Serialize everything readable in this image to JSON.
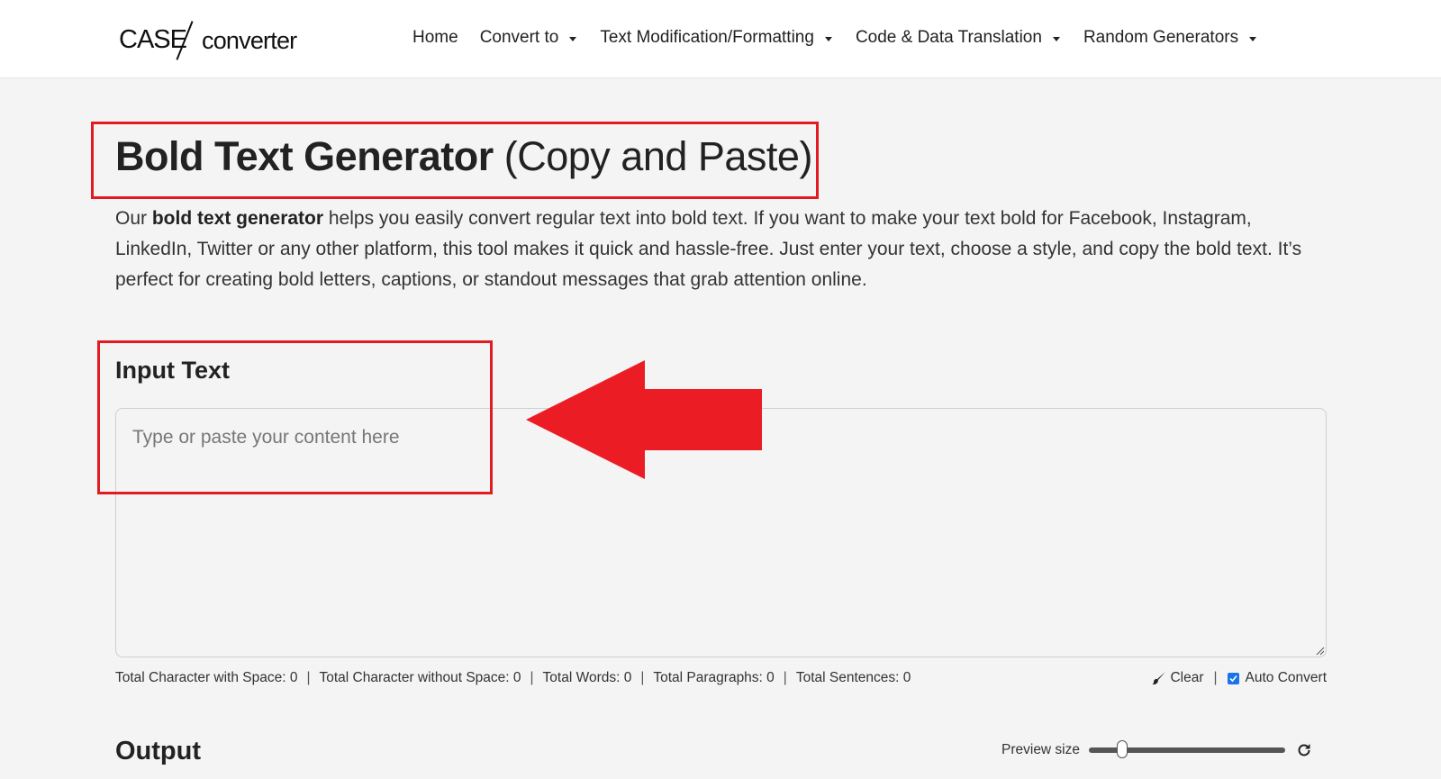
{
  "brand": {
    "logo_left": "CASE",
    "logo_right": "converter"
  },
  "nav": {
    "items": [
      {
        "label": "Home",
        "dropdown": false
      },
      {
        "label": "Convert to",
        "dropdown": true
      },
      {
        "label": "Text Modification/Formatting",
        "dropdown": true
      },
      {
        "label": "Code & Data Translation",
        "dropdown": true
      },
      {
        "label": "Random Generators",
        "dropdown": true
      }
    ]
  },
  "page": {
    "title_bold": "Bold Text Generator",
    "title_light": "(Copy and Paste)",
    "intro_prefix": "Our ",
    "intro_bold": "bold text generator",
    "intro_rest": " helps you easily convert regular text into bold text. If you want to make your text bold for Facebook, Instagram, LinkedIn, Twitter or any other platform, this tool makes it quick and hassle-free. Just enter your text, choose a style, and copy the bold text. It’s perfect for creating bold letters, captions, or standout messages that grab attention online."
  },
  "input": {
    "heading": "Input Text",
    "placeholder": "Type or paste your content here",
    "value": ""
  },
  "stats": {
    "chars_with_space": "Total Character with Space: 0",
    "chars_without_space": "Total Character without Space: 0",
    "words": "Total Words: 0",
    "paragraphs": "Total Paragraphs: 0",
    "sentences": "Total Sentences: 0"
  },
  "controls": {
    "clear_label": "Clear",
    "auto_convert_label": "Auto Convert",
    "auto_convert_checked": true
  },
  "output": {
    "heading": "Output",
    "preview_label": "Preview size",
    "preview_level": 0.15
  },
  "colors": {
    "highlight": "#e11b22",
    "arrow": "#ec1c24",
    "checkbox": "#1a73e8"
  },
  "icons": [
    "brush-icon",
    "checkbox-icon",
    "reset-icon",
    "chevron-down-icon"
  ]
}
